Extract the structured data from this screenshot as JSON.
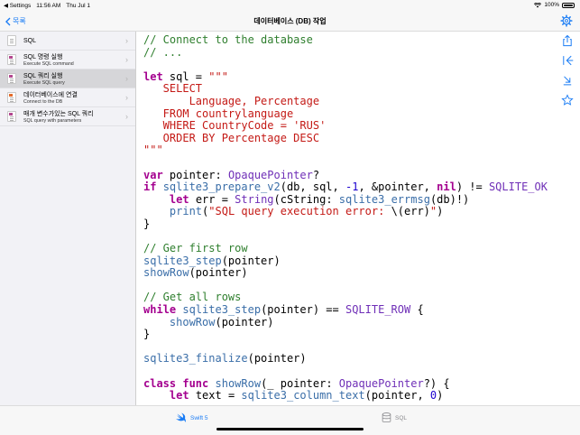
{
  "status_bar": {
    "back_app": "◀ Settings",
    "time": "11:56 AM",
    "date": "Thu Jul 1",
    "battery": "100%"
  },
  "nav": {
    "back_label": "목록",
    "title": "데이터베이스 (DB) 작업"
  },
  "sidebar": {
    "items": [
      {
        "title": "SQL",
        "subtitle": "",
        "selected": false
      },
      {
        "title": "SQL 명령 실행",
        "subtitle": "Execute SQL command",
        "selected": false
      },
      {
        "title": "SQL 쿼리 실행",
        "subtitle": "Execute SQL query",
        "selected": true
      },
      {
        "title": "데이터베이스에 연결",
        "subtitle": "Connect to the DB",
        "selected": false
      },
      {
        "title": "매개 변수가있는 SQL 쿼리",
        "subtitle": "SQL query with parameters",
        "selected": false
      }
    ]
  },
  "tools": [
    "share-icon",
    "collapse-icon",
    "expand-icon",
    "star-icon"
  ],
  "code_lines": [
    [
      [
        "c",
        "// Connect to the database"
      ]
    ],
    [
      [
        "c",
        "// ..."
      ]
    ],
    [],
    [
      [
        "k",
        "let"
      ],
      [
        "p",
        " sql = "
      ],
      [
        "s",
        "\"\"\""
      ]
    ],
    [
      [
        "s",
        "   SELECT"
      ]
    ],
    [
      [
        "s",
        "       Language, Percentage"
      ]
    ],
    [
      [
        "s",
        "   FROM countrylanguage"
      ]
    ],
    [
      [
        "s",
        "   WHERE CountryCode = 'RUS'"
      ]
    ],
    [
      [
        "s",
        "   ORDER BY Percentage DESC"
      ]
    ],
    [
      [
        "s",
        "\"\"\""
      ]
    ],
    [],
    [
      [
        "k",
        "var"
      ],
      [
        "p",
        " pointer: "
      ],
      [
        "t",
        "OpaquePointer"
      ],
      [
        "p",
        "?"
      ]
    ],
    [
      [
        "k",
        "if"
      ],
      [
        "p",
        " "
      ],
      [
        "f",
        "sqlite3_prepare_v2"
      ],
      [
        "p",
        "(db, sql, "
      ],
      [
        "n",
        "-1"
      ],
      [
        "p",
        ", &pointer, "
      ],
      [
        "k",
        "nil"
      ],
      [
        "p",
        ") != "
      ],
      [
        "x",
        "SQLITE_OK"
      ],
      [
        "p",
        " {"
      ]
    ],
    [
      [
        "p",
        "    "
      ],
      [
        "k",
        "let"
      ],
      [
        "p",
        " err = "
      ],
      [
        "t",
        "String"
      ],
      [
        "p",
        "(cString: "
      ],
      [
        "f",
        "sqlite3_errmsg"
      ],
      [
        "p",
        "(db)!)"
      ]
    ],
    [
      [
        "p",
        "    "
      ],
      [
        "f",
        "print"
      ],
      [
        "p",
        "("
      ],
      [
        "s",
        "\"SQL query execution error: "
      ],
      [
        "p",
        "\\(err)"
      ],
      [
        "s",
        "\""
      ],
      [
        "p",
        ")"
      ]
    ],
    [
      [
        "p",
        "}"
      ]
    ],
    [],
    [
      [
        "c",
        "// Ger first row"
      ]
    ],
    [
      [
        "f",
        "sqlite3_step"
      ],
      [
        "p",
        "(pointer)"
      ]
    ],
    [
      [
        "f",
        "showRow"
      ],
      [
        "p",
        "(pointer)"
      ]
    ],
    [],
    [
      [
        "c",
        "// Get all rows"
      ]
    ],
    [
      [
        "k",
        "while"
      ],
      [
        "p",
        " "
      ],
      [
        "f",
        "sqlite3_step"
      ],
      [
        "p",
        "(pointer) == "
      ],
      [
        "x",
        "SQLITE_ROW"
      ],
      [
        "p",
        " {"
      ]
    ],
    [
      [
        "p",
        "    "
      ],
      [
        "f",
        "showRow"
      ],
      [
        "p",
        "(pointer)"
      ]
    ],
    [
      [
        "p",
        "}"
      ]
    ],
    [],
    [
      [
        "f",
        "sqlite3_finalize"
      ],
      [
        "p",
        "(pointer)"
      ]
    ],
    [],
    [
      [
        "k",
        "class"
      ],
      [
        "p",
        " "
      ],
      [
        "k",
        "func"
      ],
      [
        "p",
        " "
      ],
      [
        "f",
        "showRow"
      ],
      [
        "p",
        "(_ pointer: "
      ],
      [
        "t",
        "OpaquePointer"
      ],
      [
        "p",
        "?) {"
      ]
    ],
    [
      [
        "p",
        "    "
      ],
      [
        "k",
        "let"
      ],
      [
        "p",
        " text = "
      ],
      [
        "f",
        "sqlite3_column_text"
      ],
      [
        "p",
        "(pointer, "
      ],
      [
        "n",
        "0"
      ],
      [
        "p",
        ")"
      ]
    ]
  ],
  "tabs": [
    {
      "label": "Swift 5",
      "active": true,
      "icon": "swift-icon"
    },
    {
      "label": "SQL",
      "active": false,
      "icon": "database-icon"
    }
  ],
  "colors": {
    "accent": "#1a7cf5",
    "comment": "#2f7f2e",
    "keyword": "#a4008f",
    "string": "#c41a16"
  }
}
